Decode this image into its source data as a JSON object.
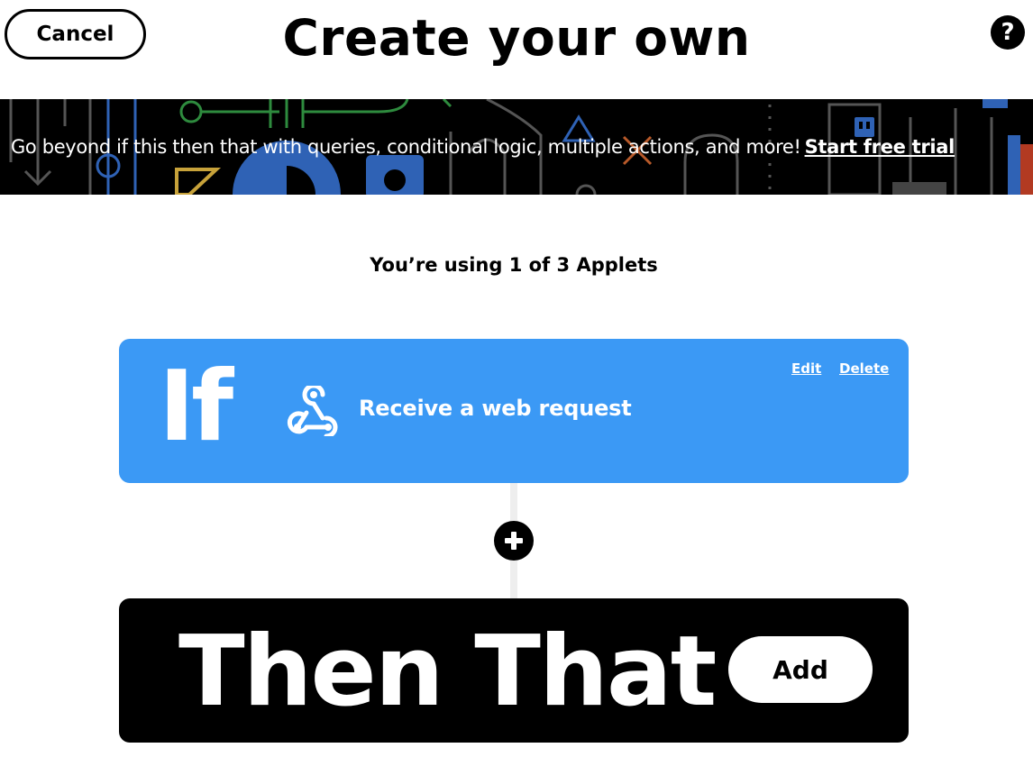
{
  "header": {
    "cancel_label": "Cancel",
    "title": "Create your own",
    "help_icon": "question-mark-icon",
    "help_glyph": "?"
  },
  "banner": {
    "message": "Go beyond if this then that with queries, conditional logic, multiple actions, and more!",
    "link_label": "Start free trial"
  },
  "usage": {
    "text": "You’re using 1 of 3 Applets"
  },
  "trigger": {
    "keyword": "If",
    "service_icon": "webhook-icon",
    "label": "Receive a web request",
    "edit_label": "Edit",
    "delete_label": "Delete",
    "color": "#3b99f5"
  },
  "connector": {
    "add_icon": "plus-icon"
  },
  "action": {
    "keyword": "Then That",
    "add_label": "Add",
    "color": "#000000"
  }
}
